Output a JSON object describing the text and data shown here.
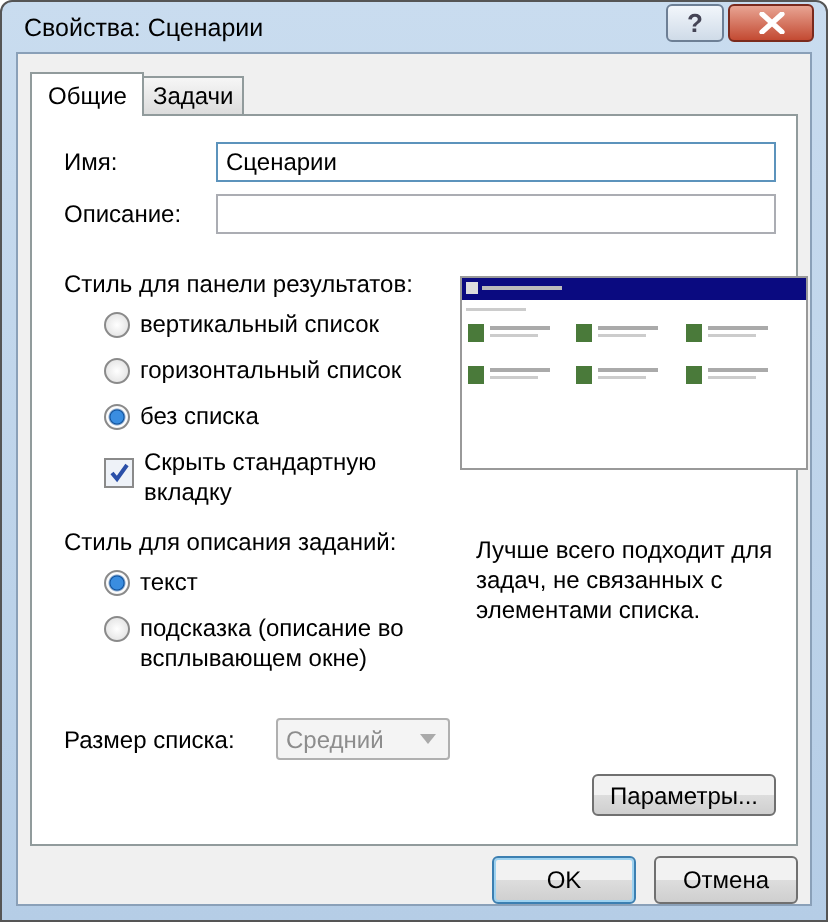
{
  "window": {
    "title": "Свойства: Сценарии",
    "help": "?"
  },
  "tabs": [
    {
      "label": "Общие",
      "selected": true
    },
    {
      "label": "Задачи",
      "selected": false
    }
  ],
  "fields": [
    {
      "label": "Имя:",
      "value": "Сценарии"
    },
    {
      "label": "Описание:"
    }
  ],
  "results_style": {
    "label": "Стиль для панели результатов:",
    "options": [
      {
        "label": "вертикальный список",
        "selected": false
      },
      {
        "label": "горизонтальный список",
        "selected": false
      },
      {
        "label": "без списка",
        "selected": true
      }
    ]
  },
  "hide_tab": {
    "label": "Скрыть стандартную вкладку",
    "checked": true
  },
  "description_style": {
    "label": "Стиль для описания заданий:",
    "options": [
      {
        "label": "текст",
        "selected": true
      },
      {
        "label": "подсказка (описание во всплывающем окне)",
        "selected": false
      }
    ]
  },
  "hint": "Лучше всего подходит для задач, не связанных с элементами списка.",
  "list_size": {
    "label": "Размер списка:",
    "value": "Средний",
    "disabled": true
  },
  "params_button": "Параметры...",
  "buttons": [
    {
      "label": "OK",
      "default": true
    },
    {
      "label": "Отмена",
      "default": false
    }
  ]
}
